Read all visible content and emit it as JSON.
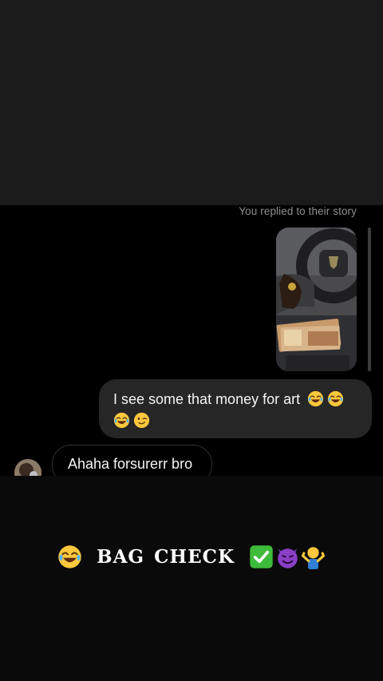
{
  "chat": {
    "story_caption": "You replied to their story",
    "outgoing_message": {
      "text": "I see some that money for art",
      "emojis": [
        "joy-emoji",
        "joy-emoji",
        "joy-emoji",
        "wink-emoji"
      ]
    },
    "incoming_message": {
      "text": "Ahaha forsurerr bro"
    }
  },
  "story_overlay": {
    "word1": "BAG",
    "word2": "CHECK",
    "leading_emoji": "joy-emoji",
    "trailing_emojis": [
      "check-mark-emoji",
      "smiling-devil-emoji",
      "shrug-emoji"
    ]
  },
  "colors": {
    "top_band": "#1b1b1b",
    "chat_background": "#000000",
    "outgoing_bubble": "#262626",
    "caption_gray": "#8e8e8e",
    "emoji_yellow": "#ffc83d",
    "check_green": "#3dbb3a",
    "devil_purple": "#8a3fc7"
  }
}
